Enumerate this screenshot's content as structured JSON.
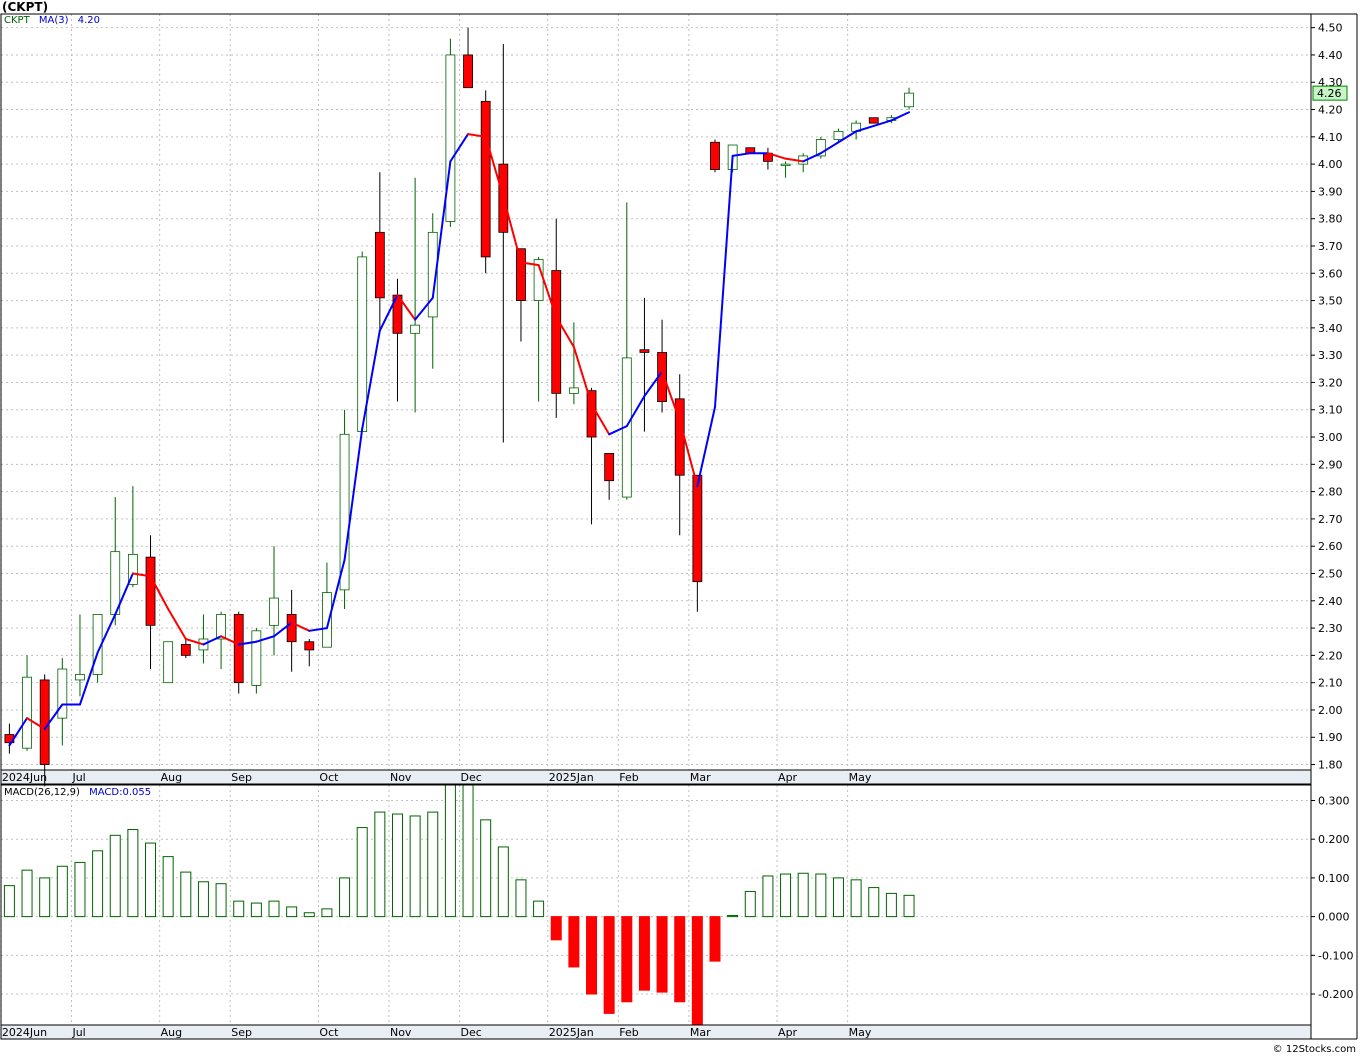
{
  "title": "(CKPT)",
  "legend": {
    "symbol": "CKPT",
    "ma_label": "MA(3)",
    "ma_value": "4.20"
  },
  "macd_legend": {
    "name": "MACD(26,12,9)",
    "value": "MACD:0.055"
  },
  "copyright": "© 12Stocks.com",
  "colors": {
    "up_candle": "#006400",
    "down_candle": "#ff0000",
    "ma_up": "#0000ff",
    "ma_down": "#ff0000",
    "grid": "#c0c0c0",
    "axis_band": "#e8eef4",
    "last_price_box": "#c8f5c8"
  },
  "chart_data": [
    {
      "type": "candlestick",
      "title": "(CKPT)",
      "interval": "weekly",
      "y_axis_side": "right",
      "ylim": [
        1.78,
        4.55
      ],
      "yticks": [
        "1.80",
        "1.90",
        "2.00",
        "2.10",
        "2.20",
        "2.30",
        "2.40",
        "2.50",
        "2.60",
        "2.70",
        "2.80",
        "2.90",
        "3.00",
        "3.10",
        "3.20",
        "3.30",
        "3.40",
        "3.50",
        "3.60",
        "3.70",
        "3.80",
        "3.90",
        "4.00",
        "4.10",
        "4.20",
        "4.30",
        "4.40",
        "4.50"
      ],
      "month_labels": [
        {
          "label": "2024Jun",
          "week": 0
        },
        {
          "label": "Jul",
          "week": 4
        },
        {
          "label": "Aug",
          "week": 9
        },
        {
          "label": "Sep",
          "week": 13
        },
        {
          "label": "Oct",
          "week": 18
        },
        {
          "label": "Nov",
          "week": 22
        },
        {
          "label": "Dec",
          "week": 26
        },
        {
          "label": "2025Jan",
          "week": 31
        },
        {
          "label": "Feb",
          "week": 35
        },
        {
          "label": "Mar",
          "week": 39
        },
        {
          "label": "Apr",
          "week": 44
        },
        {
          "label": "May",
          "week": 48
        }
      ],
      "last_price": "4.26",
      "grid": true,
      "candles": [
        {
          "o": 1.91,
          "h": 1.95,
          "l": 1.84,
          "c": 1.88
        },
        {
          "o": 1.86,
          "h": 2.2,
          "l": 1.85,
          "c": 2.12
        },
        {
          "o": 2.11,
          "h": 2.13,
          "l": 1.72,
          "c": 1.8
        },
        {
          "o": 1.97,
          "h": 2.19,
          "l": 1.87,
          "c": 2.15
        },
        {
          "o": 2.11,
          "h": 2.35,
          "l": 2.05,
          "c": 2.13
        },
        {
          "o": 2.13,
          "h": 2.35,
          "l": 2.1,
          "c": 2.35
        },
        {
          "o": 2.35,
          "h": 2.78,
          "l": 2.31,
          "c": 2.58
        },
        {
          "o": 2.46,
          "h": 2.82,
          "l": 2.45,
          "c": 2.57
        },
        {
          "o": 2.56,
          "h": 2.64,
          "l": 2.15,
          "c": 2.31
        },
        {
          "o": 2.1,
          "h": 2.25,
          "l": 2.1,
          "c": 2.25
        },
        {
          "o": 2.24,
          "h": 2.26,
          "l": 2.19,
          "c": 2.2
        },
        {
          "o": 2.22,
          "h": 2.35,
          "l": 2.17,
          "c": 2.26
        },
        {
          "o": 2.26,
          "h": 2.36,
          "l": 2.15,
          "c": 2.35
        },
        {
          "o": 2.35,
          "h": 2.36,
          "l": 2.06,
          "c": 2.1
        },
        {
          "o": 2.09,
          "h": 2.3,
          "l": 2.06,
          "c": 2.29
        },
        {
          "o": 2.31,
          "h": 2.6,
          "l": 2.2,
          "c": 2.41
        },
        {
          "o": 2.35,
          "h": 2.44,
          "l": 2.14,
          "c": 2.25
        },
        {
          "o": 2.25,
          "h": 2.26,
          "l": 2.16,
          "c": 2.22
        },
        {
          "o": 2.23,
          "h": 2.54,
          "l": 2.23,
          "c": 2.43
        },
        {
          "o": 2.44,
          "h": 3.1,
          "l": 2.37,
          "c": 3.01
        },
        {
          "o": 3.02,
          "h": 3.68,
          "l": 3.02,
          "c": 3.66
        },
        {
          "o": 3.75,
          "h": 3.97,
          "l": 3.38,
          "c": 3.51
        },
        {
          "o": 3.52,
          "h": 3.58,
          "l": 3.13,
          "c": 3.38
        },
        {
          "o": 3.38,
          "h": 3.95,
          "l": 3.09,
          "c": 3.41
        },
        {
          "o": 3.44,
          "h": 3.82,
          "l": 3.25,
          "c": 3.75
        },
        {
          "o": 3.79,
          "h": 4.46,
          "l": 3.77,
          "c": 4.4
        },
        {
          "o": 4.4,
          "h": 4.5,
          "l": 4.28,
          "c": 4.28
        },
        {
          "o": 4.23,
          "h": 4.27,
          "l": 3.6,
          "c": 3.66
        },
        {
          "o": 4.0,
          "h": 4.44,
          "l": 2.98,
          "c": 3.75
        },
        {
          "o": 3.69,
          "h": 3.69,
          "l": 3.35,
          "c": 3.5
        },
        {
          "o": 3.5,
          "h": 3.66,
          "l": 3.13,
          "c": 3.65
        },
        {
          "o": 3.61,
          "h": 3.8,
          "l": 3.07,
          "c": 3.16
        },
        {
          "o": 3.16,
          "h": 3.42,
          "l": 3.12,
          "c": 3.18
        },
        {
          "o": 3.17,
          "h": 3.18,
          "l": 2.68,
          "c": 3.0
        },
        {
          "o": 2.94,
          "h": 2.94,
          "l": 2.77,
          "c": 2.84
        },
        {
          "o": 2.78,
          "h": 3.86,
          "l": 2.77,
          "c": 3.29
        },
        {
          "o": 3.32,
          "h": 3.51,
          "l": 3.02,
          "c": 3.31
        },
        {
          "o": 3.31,
          "h": 3.43,
          "l": 3.09,
          "c": 3.13
        },
        {
          "o": 3.14,
          "h": 3.23,
          "l": 2.64,
          "c": 2.86
        },
        {
          "o": 2.86,
          "h": 2.86,
          "l": 2.36,
          "c": 2.47
        },
        {
          "o": 4.08,
          "h": 4.09,
          "l": 3.97,
          "c": 3.98
        },
        {
          "o": 3.98,
          "h": 4.07,
          "l": 3.97,
          "c": 4.07
        },
        {
          "o": 4.06,
          "h": 4.06,
          "l": 4.04,
          "c": 4.04
        },
        {
          "o": 4.04,
          "h": 4.06,
          "l": 3.98,
          "c": 4.01
        },
        {
          "o": 4.0,
          "h": 4.01,
          "l": 3.95,
          "c": 4.0
        },
        {
          "o": 4.0,
          "h": 4.04,
          "l": 3.97,
          "c": 4.03
        },
        {
          "o": 4.03,
          "h": 4.1,
          "l": 4.02,
          "c": 4.09
        },
        {
          "o": 4.09,
          "h": 4.13,
          "l": 4.08,
          "c": 4.12
        },
        {
          "o": 4.12,
          "h": 4.16,
          "l": 4.09,
          "c": 4.15
        },
        {
          "o": 4.17,
          "h": 4.17,
          "l": 4.15,
          "c": 4.15
        },
        {
          "o": 4.16,
          "h": 4.18,
          "l": 4.15,
          "c": 4.17
        },
        {
          "o": 4.21,
          "h": 4.28,
          "l": 4.2,
          "c": 4.26
        }
      ],
      "ma": {
        "name": "MA(3)",
        "values": [
          1.87,
          1.97,
          1.93,
          2.02,
          2.02,
          2.21,
          2.35,
          2.5,
          2.49,
          2.37,
          2.26,
          2.24,
          2.27,
          2.24,
          2.25,
          2.27,
          2.32,
          2.29,
          2.3,
          2.55,
          3.03,
          3.39,
          3.52,
          3.43,
          3.51,
          4.01,
          4.11,
          4.1,
          3.88,
          3.64,
          3.63,
          3.44,
          3.33,
          3.12,
          3.01,
          3.04,
          3.15,
          3.24,
          3.06,
          2.82,
          3.11,
          4.03,
          4.04,
          4.04,
          4.02,
          4.01,
          4.04,
          4.08,
          4.12,
          4.14,
          4.16,
          4.19
        ]
      }
    },
    {
      "type": "bar",
      "title": "MACD(26,12,9)",
      "ylim": [
        -0.28,
        0.34
      ],
      "yticks": [
        "-0.200",
        "-0.100",
        "0.000",
        "0.100",
        "0.200",
        "0.300"
      ],
      "values": [
        0.08,
        0.12,
        0.1,
        0.13,
        0.14,
        0.17,
        0.21,
        0.225,
        0.19,
        0.155,
        0.115,
        0.09,
        0.085,
        0.04,
        0.035,
        0.04,
        0.025,
        0.01,
        0.02,
        0.1,
        0.23,
        0.27,
        0.265,
        0.26,
        0.27,
        0.34,
        0.34,
        0.25,
        0.18,
        0.095,
        0.04,
        -0.06,
        -0.13,
        -0.2,
        -0.25,
        -0.22,
        -0.19,
        -0.195,
        -0.22,
        -0.28,
        -0.115,
        0.003,
        0.065,
        0.105,
        0.11,
        0.112,
        0.11,
        0.1,
        0.095,
        0.075,
        0.06,
        0.055
      ]
    }
  ]
}
